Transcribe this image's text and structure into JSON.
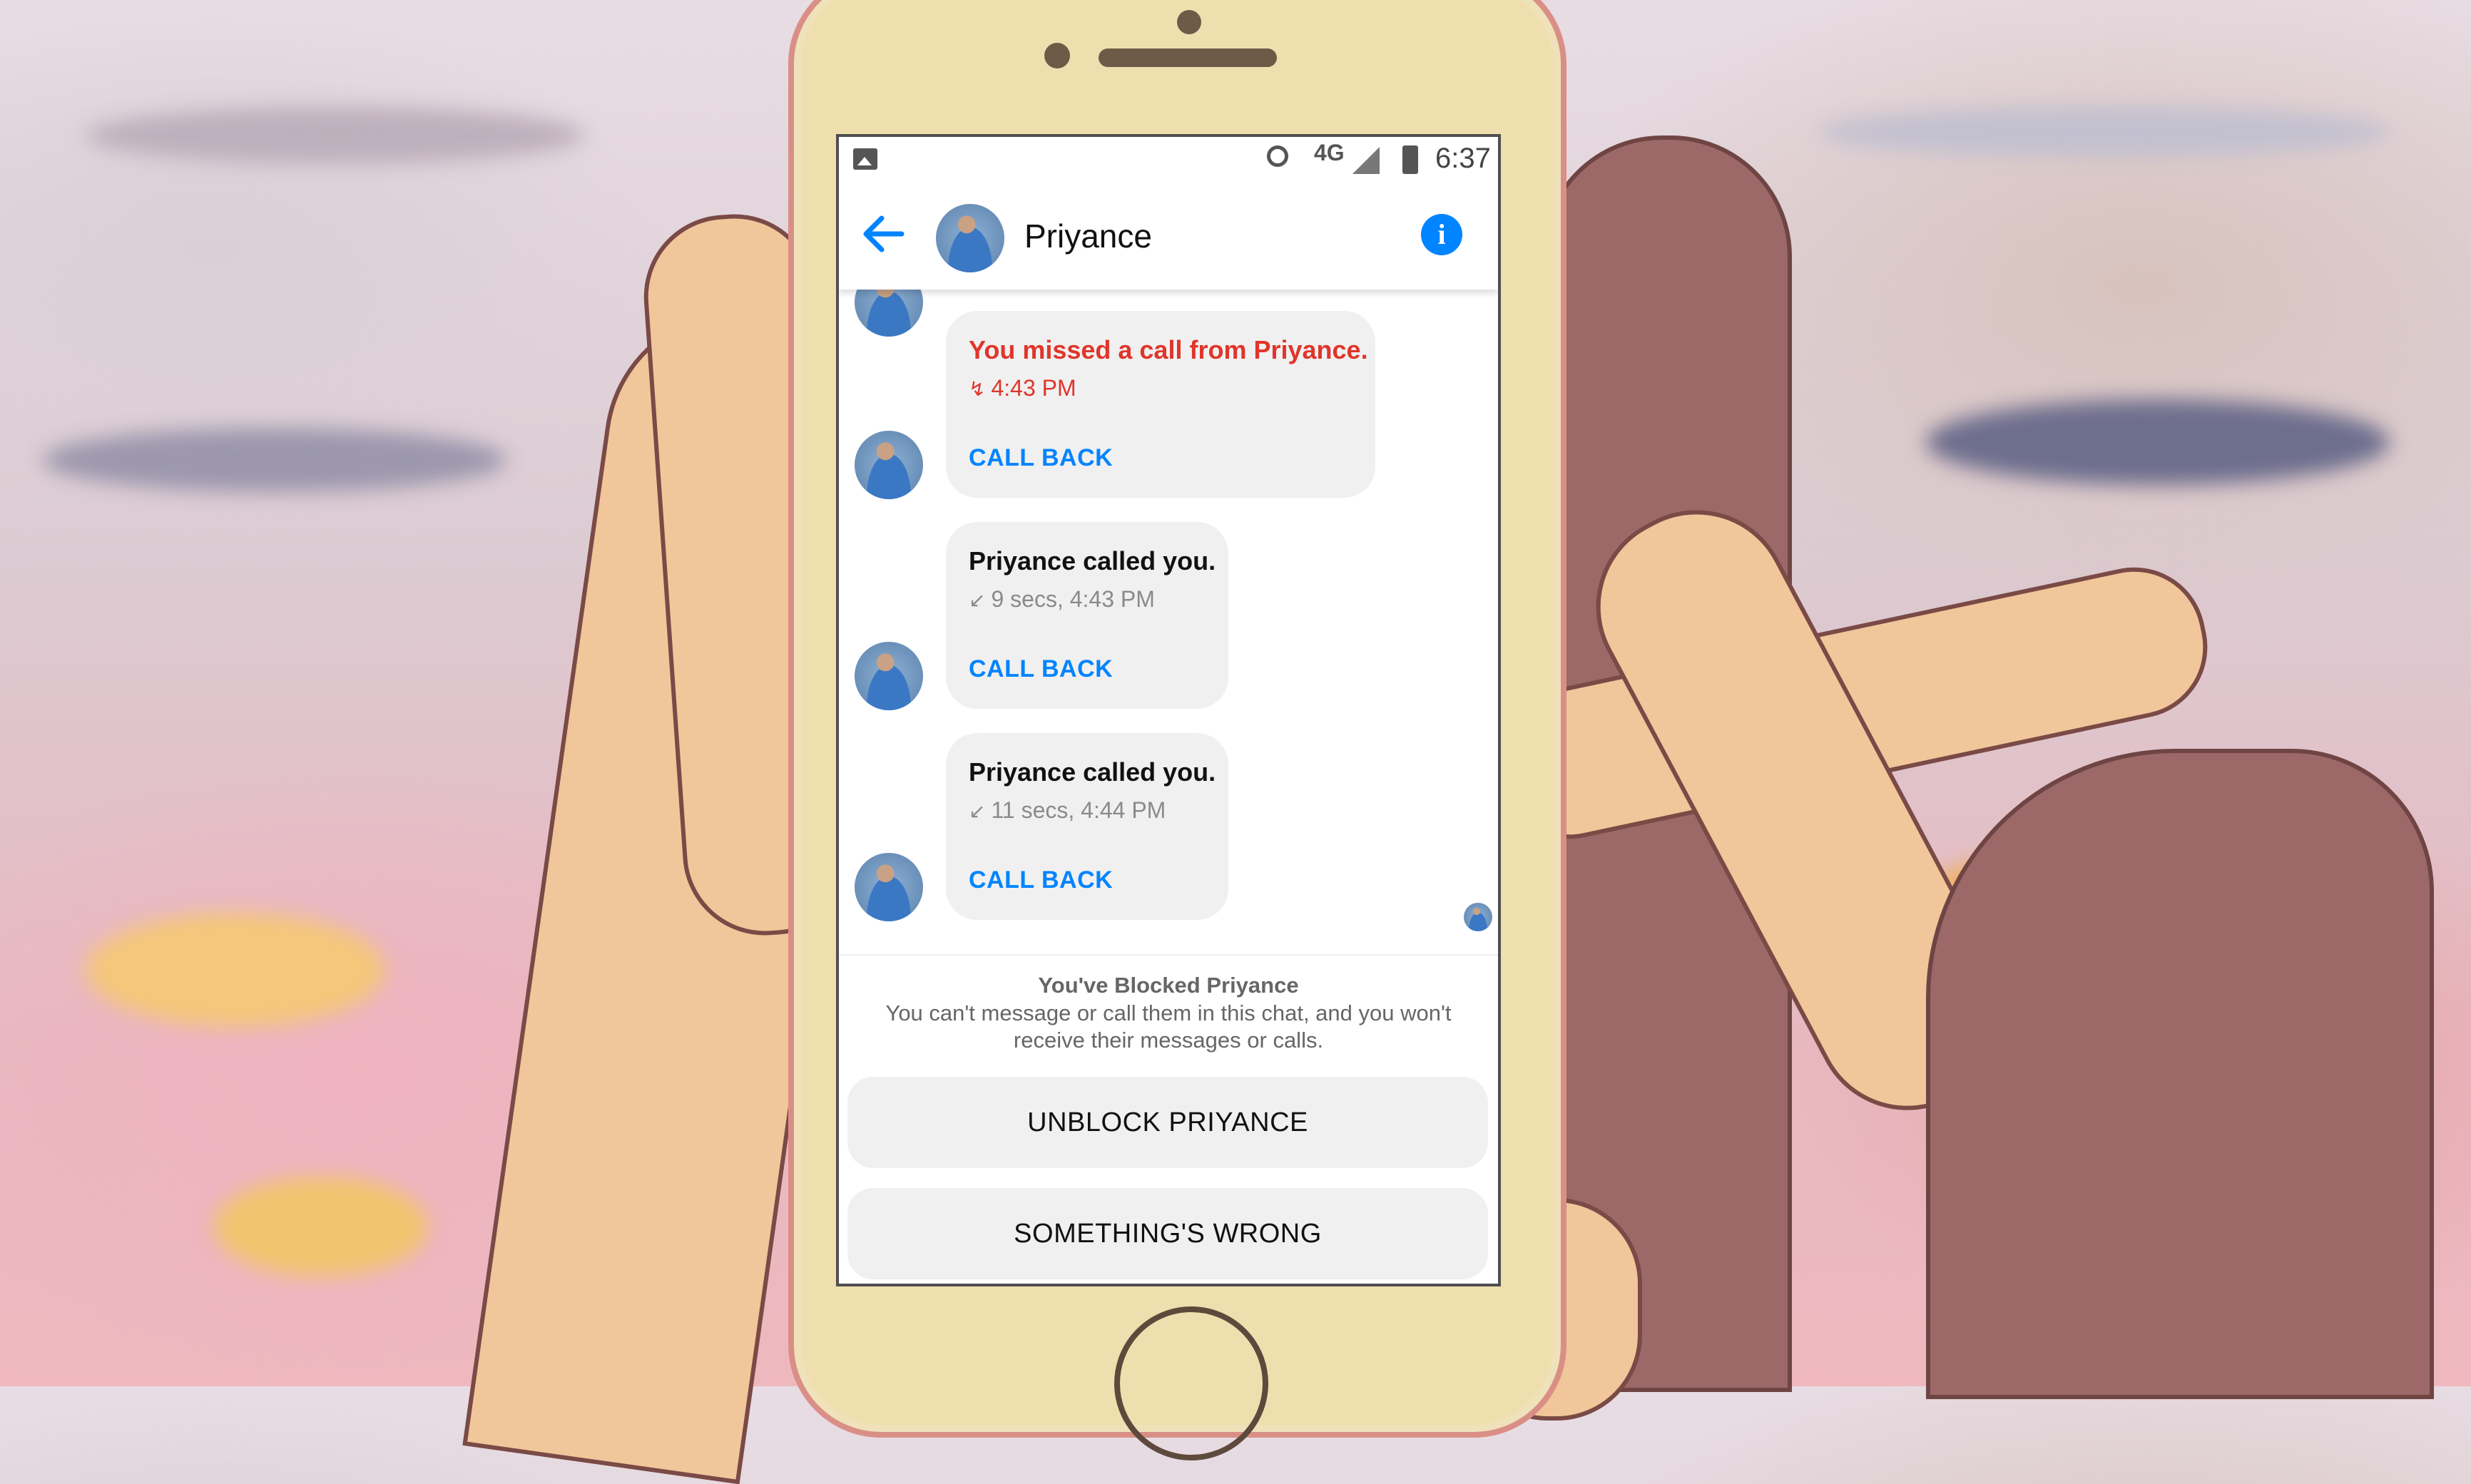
{
  "status_bar": {
    "network": "4G",
    "time": "6:37",
    "icons": [
      "gallery-icon",
      "alarm-icon",
      "signal-icon",
      "battery-icon"
    ]
  },
  "header": {
    "contact_name": "Priyance",
    "back_icon": "arrow-left-icon",
    "info_icon": "info-icon",
    "info_glyph": "i"
  },
  "messages": [
    {
      "title": "You missed a call from Priyance.",
      "meta": "4:43 PM",
      "meta_icon": "missed-call-arrow",
      "meta_arrow": "↯",
      "action": "CALL BACK",
      "missed": true
    },
    {
      "title": "Priyance called you.",
      "meta": "9 secs, 4:43 PM",
      "meta_icon": "incoming-call-arrow",
      "meta_arrow": "↙",
      "action": "CALL BACK",
      "missed": false
    },
    {
      "title": "Priyance called you.",
      "meta": "11 secs, 4:44 PM",
      "meta_icon": "incoming-call-arrow",
      "meta_arrow": "↙",
      "action": "CALL BACK",
      "missed": false
    }
  ],
  "blocked": {
    "title": "You've Blocked Priyance",
    "description": "You can't message or call them in this chat, and you won't receive their messages or calls.",
    "unblock_label": "UNBLOCK PRIYANCE",
    "wrong_label": "SOMETHING'S WRONG"
  },
  "colors": {
    "accent": "#0084ff",
    "missed": "#e0352b",
    "bubble": "#f1f0f0"
  }
}
